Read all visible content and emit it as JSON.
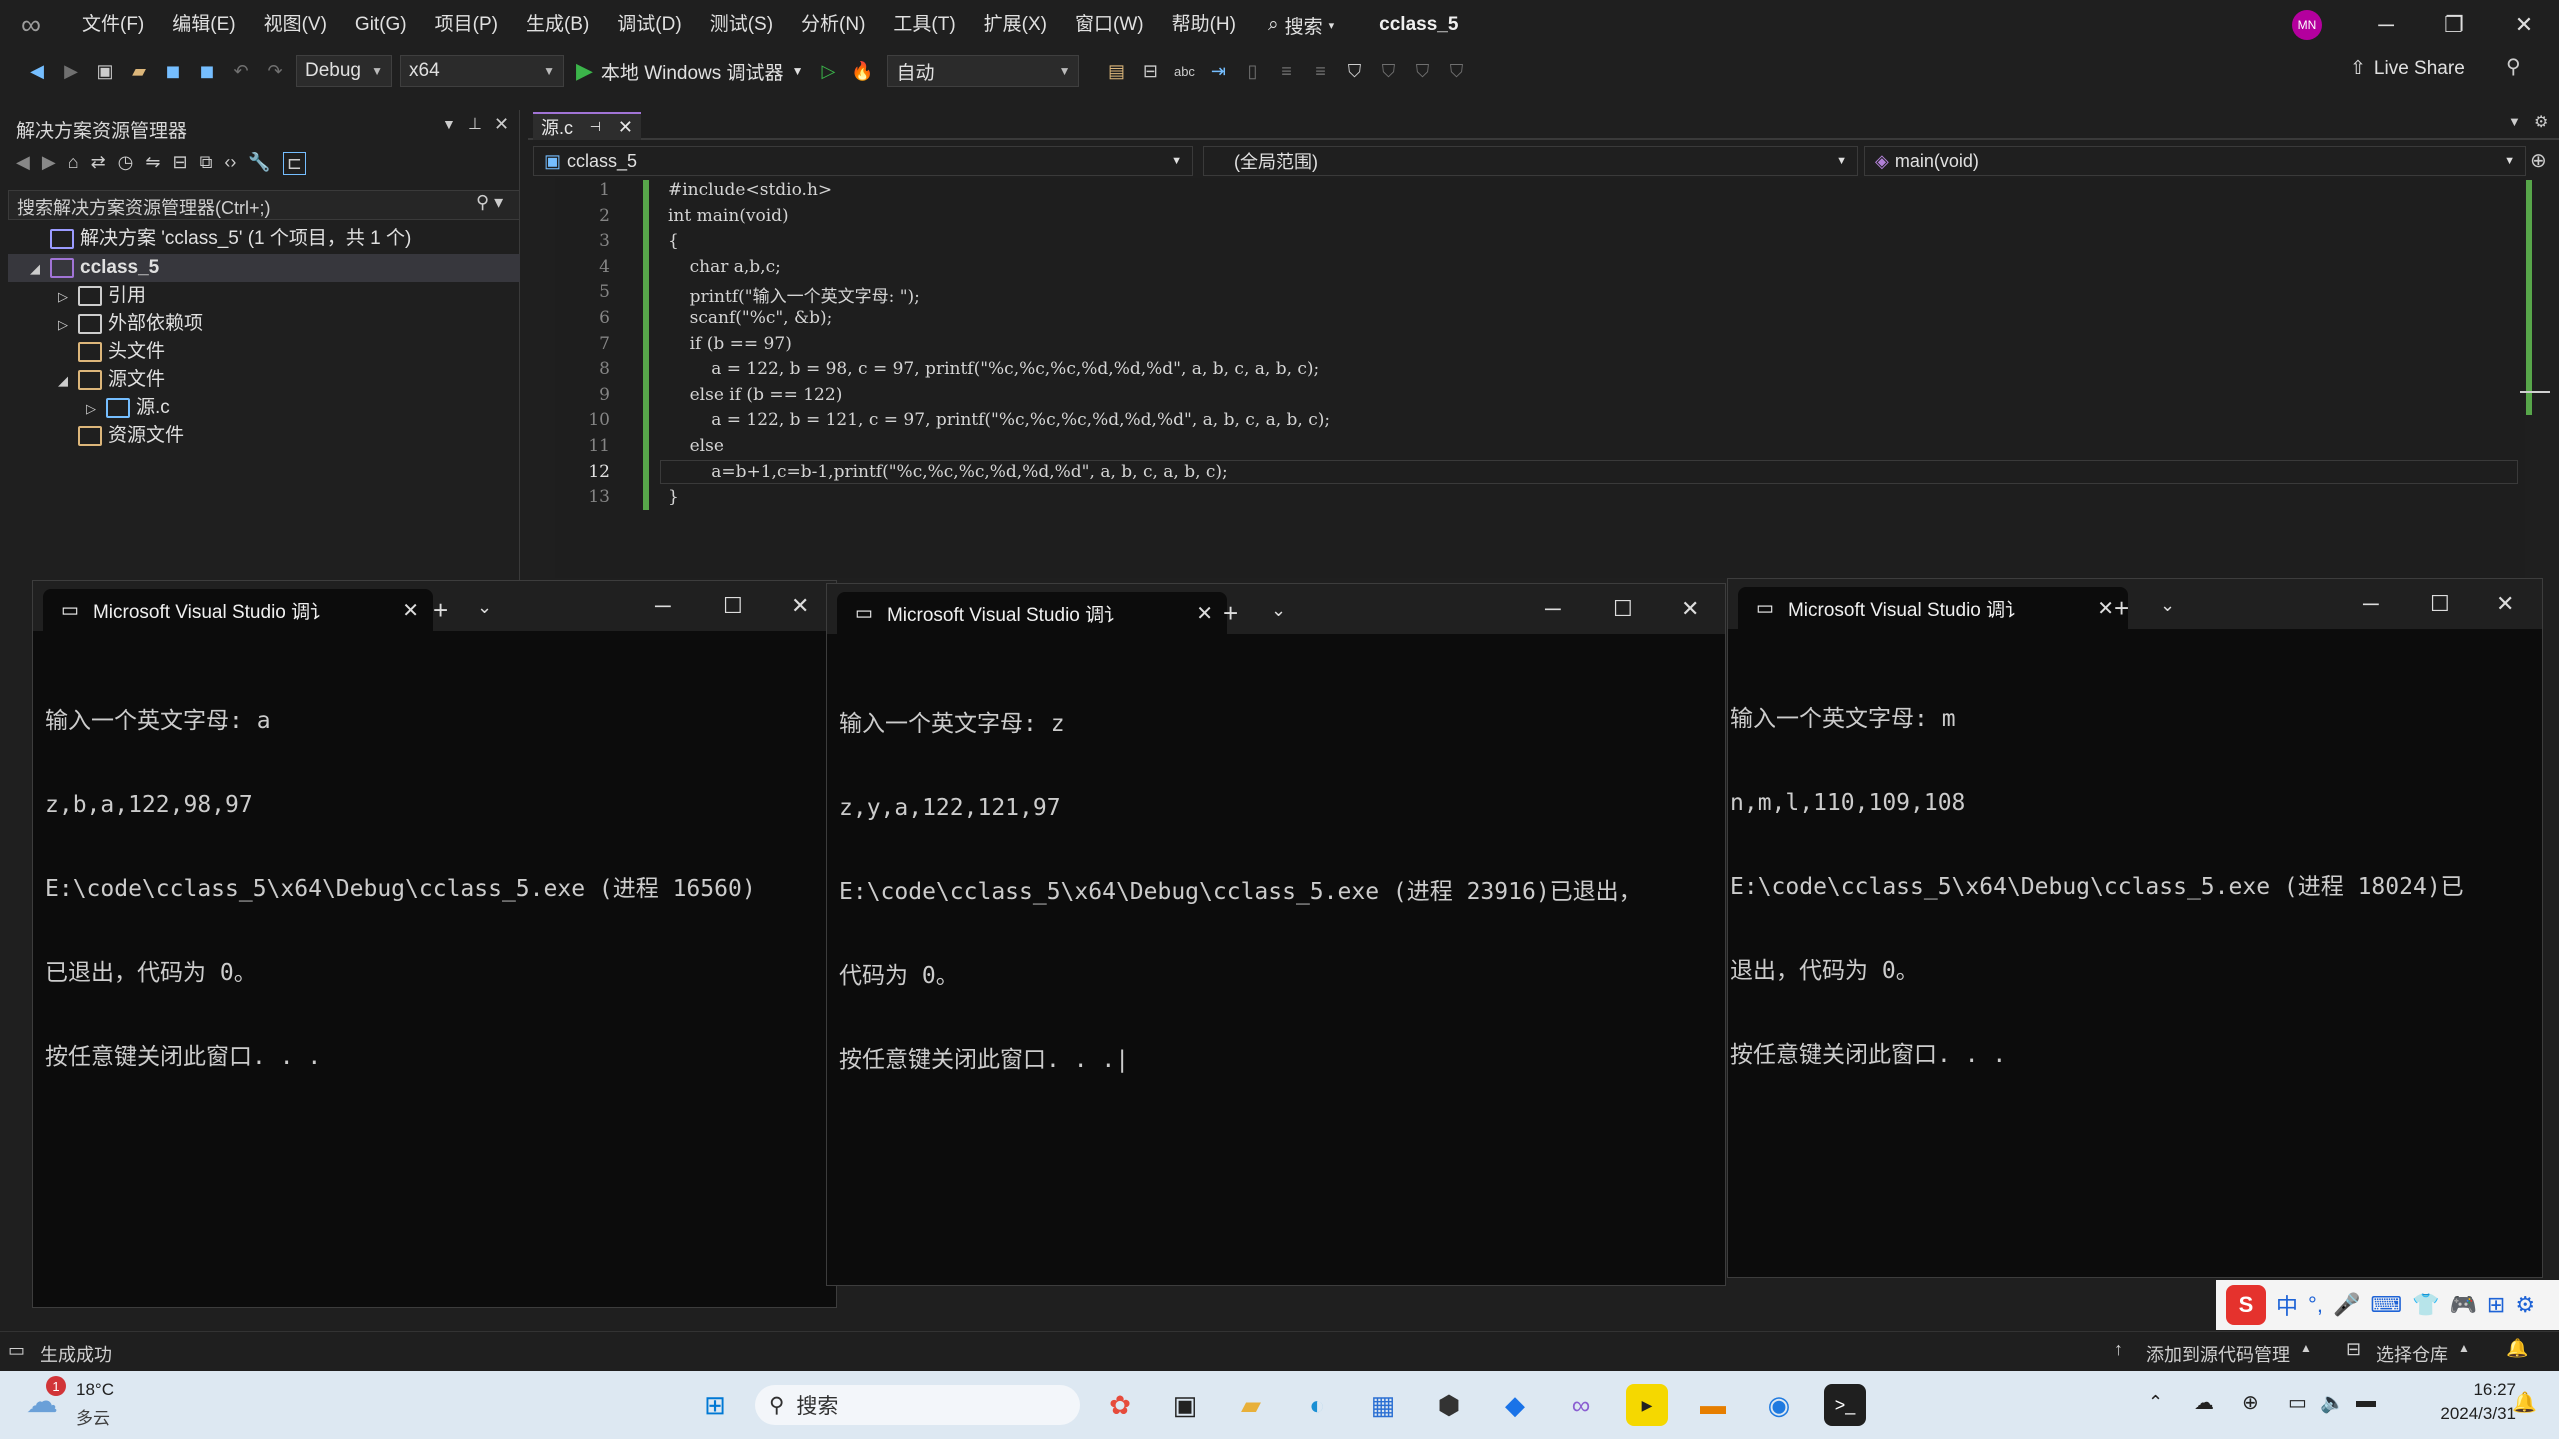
{
  "titlebar": {
    "menus": [
      "文件(F)",
      "编辑(E)",
      "视图(V)",
      "Git(G)",
      "项目(P)",
      "生成(B)",
      "调试(D)",
      "测试(S)",
      "分析(N)",
      "工具(T)",
      "扩展(X)",
      "窗口(W)",
      "帮助(H)"
    ],
    "search_label": "搜索",
    "solution_title": "cclass_5",
    "avatar_initials": "MN"
  },
  "toolbar": {
    "config": "Debug",
    "platform": "x64",
    "run_label": "本地 Windows 调试器",
    "mode": "自动",
    "live_share": "Live Share"
  },
  "solution_explorer": {
    "title": "解决方案资源管理器",
    "search_placeholder": "搜索解决方案资源管理器(Ctrl+;)",
    "tree": [
      {
        "label": "解决方案 'cclass_5' (1 个项目，共 1 个)",
        "level": 0,
        "caret": "",
        "icon_color": "#9b9bff"
      },
      {
        "label": "cclass_5",
        "level": 0,
        "caret": "◢",
        "icon_color": "#a174d6",
        "bold": true
      },
      {
        "label": "引用",
        "level": 1,
        "caret": "▷",
        "icon_color": "#cccccc"
      },
      {
        "label": "外部依赖项",
        "level": 1,
        "caret": "▷",
        "icon_color": "#cccccc"
      },
      {
        "label": "头文件",
        "level": 1,
        "caret": "",
        "icon_color": "#dcb67a"
      },
      {
        "label": "源文件",
        "level": 1,
        "caret": "◢",
        "icon_color": "#dcb67a"
      },
      {
        "label": "源.c",
        "level": 2,
        "caret": "▷",
        "icon_color": "#75beff"
      },
      {
        "label": "资源文件",
        "level": 1,
        "caret": "",
        "icon_color": "#dcb67a"
      }
    ]
  },
  "editor": {
    "tab_name": "源.c",
    "nav_project": "cclass_5",
    "nav_scope": "(全局范围)",
    "nav_function": "main(void)",
    "lines": [
      {
        "n": "1",
        "text": "#include<stdio.h>"
      },
      {
        "n": "2",
        "text": "int main(void)"
      },
      {
        "n": "3",
        "text": "{"
      },
      {
        "n": "4",
        "text": "    char a,b,c;"
      },
      {
        "n": "5",
        "text": "    printf(\"输入一个英文字母: \");"
      },
      {
        "n": "6",
        "text": "    scanf(\"%c\", &b);"
      },
      {
        "n": "7",
        "text": "    if (b == 97)"
      },
      {
        "n": "8",
        "text": "        a = 122, b = 98, c = 97, printf(\"%c,%c,%c,%d,%d,%d\", a, b, c, a, b, c);"
      },
      {
        "n": "9",
        "text": "    else if (b == 122)"
      },
      {
        "n": "10",
        "text": "        a = 122, b = 121, c = 97, printf(\"%c,%c,%c,%d,%d,%d\", a, b, c, a, b, c);"
      },
      {
        "n": "11",
        "text": "    else"
      },
      {
        "n": "12",
        "text": "        a=b+1,c=b-1,printf(\"%c,%c,%c,%d,%d,%d\", a, b, c, a, b, c);"
      },
      {
        "n": "13",
        "text": "}"
      }
    ]
  },
  "consoles": [
    {
      "tab_title": "Microsoft Visual Studio 调讠",
      "lines": [
        "输入一个英文字母: a",
        "z,b,a,122,98,97",
        "E:\\code\\cclass_5\\x64\\Debug\\cclass_5.exe (进程 16560)",
        "已退出，代码为 0。",
        "按任意键关闭此窗口. . ."
      ]
    },
    {
      "tab_title": "Microsoft Visual Studio 调讠",
      "lines": [
        "输入一个英文字母: z",
        "z,y,a,122,121,97",
        "E:\\code\\cclass_5\\x64\\Debug\\cclass_5.exe (进程 23916)已退出，",
        "代码为 0。",
        "按任意键关闭此窗口. . .|"
      ]
    },
    {
      "tab_title": "Microsoft Visual Studio 调讠",
      "lines": [
        "输入一个英文字母: m",
        "n,m,l,110,109,108",
        "E:\\code\\cclass_5\\x64\\Debug\\cclass_5.exe (进程 18024)已",
        "退出，代码为 0。",
        "按任意键关闭此窗口. . ."
      ]
    }
  ],
  "statusbar": {
    "build_status": "生成成功",
    "add_source": "添加到源代码管理",
    "select_repo": "选择仓库"
  },
  "taskbar": {
    "weather_temp": "18°C",
    "weather_desc": "多云",
    "weather_badge": "1",
    "search_label": "搜索",
    "time": "16:27",
    "date": "2024/3/31"
  },
  "ime": {
    "items": [
      "中",
      "°,",
      "🎤",
      "⌨",
      "👕",
      "🎮",
      "⊞",
      "⚙"
    ]
  }
}
